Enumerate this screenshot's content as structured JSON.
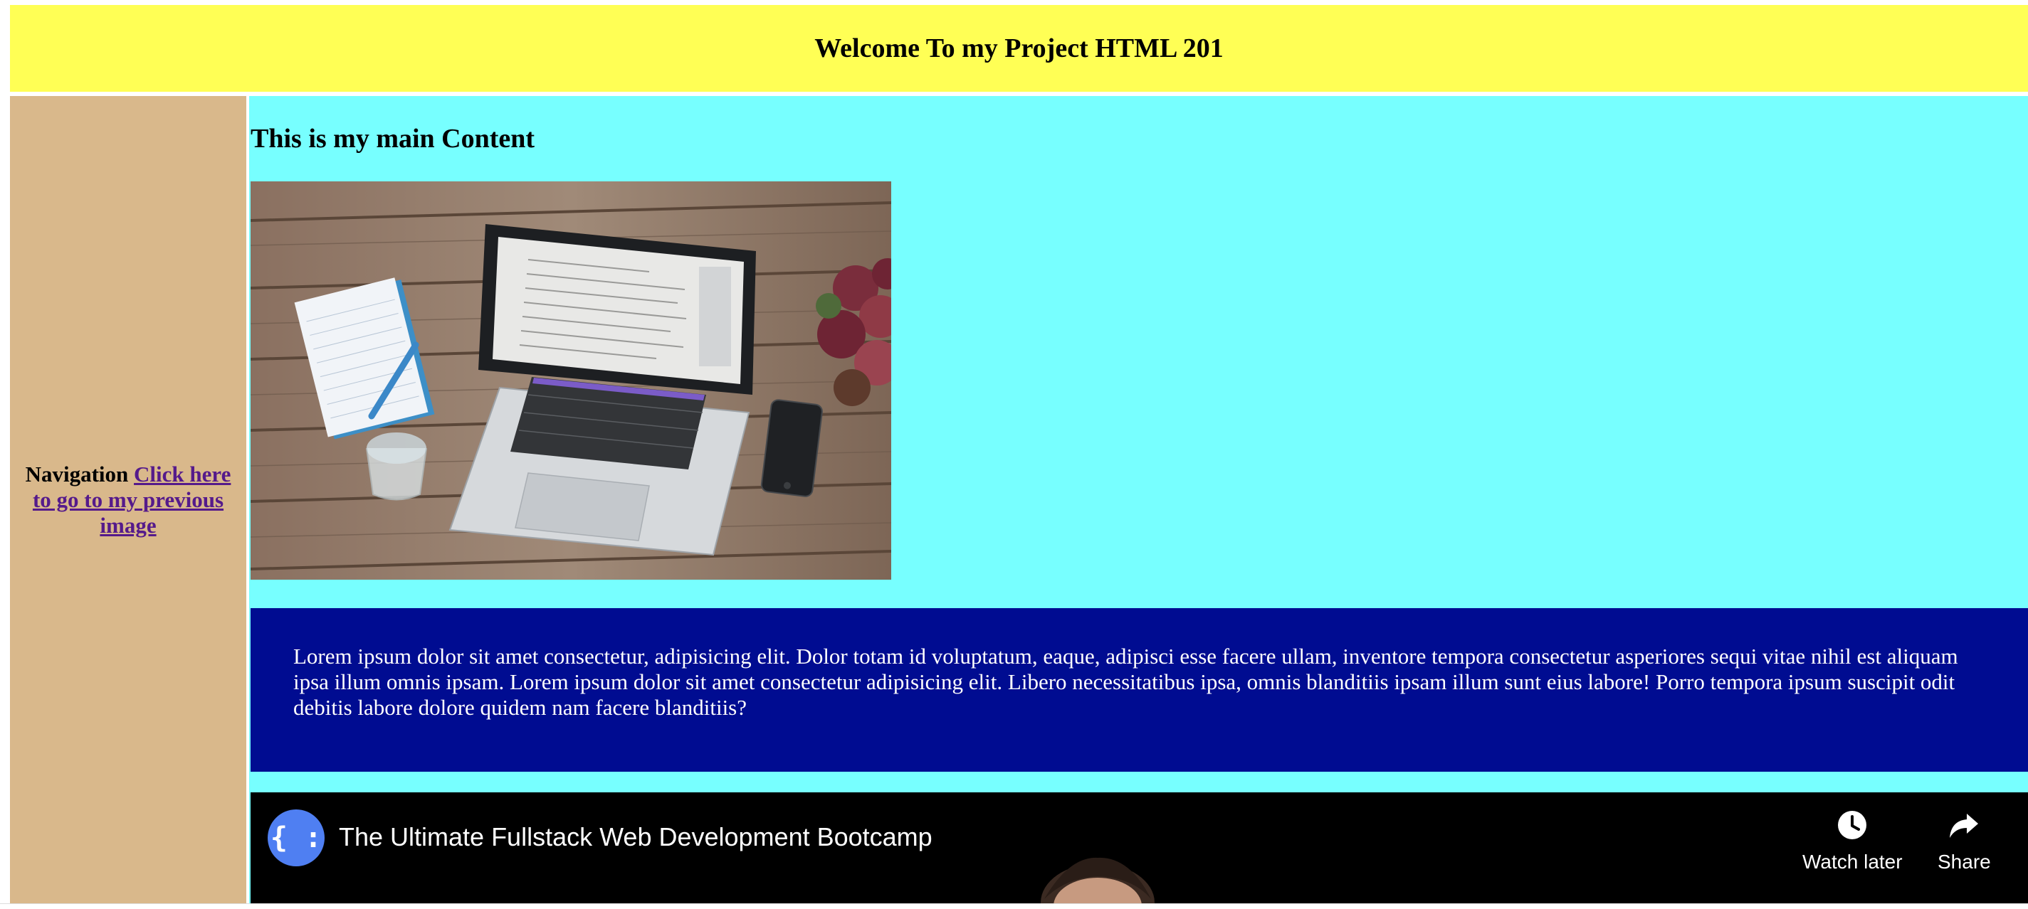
{
  "header": {
    "title": "Welcome To my Project HTML 201"
  },
  "nav": {
    "label": "Navigation",
    "link_text": "Click here to go to my previous image"
  },
  "main": {
    "heading": "This is my main Content",
    "photo_alt": "Laptop on wooden desk with notebook, pen, glass, phone and plant",
    "paragraph": "Lorem ipsum dolor sit amet consectetur, adipisicing elit. Dolor totam id voluptatum, eaque, adipisci esse facere ullam, inventore tempora consectetur asperiores sequi vitae nihil est aliquam ipsa illum omnis ipsam. Lorem ipsum dolor sit amet consectetur adipisicing elit. Libero necessitatibus ipsa, omnis blanditiis ipsam illum sunt eius labore! Porro tempora ipsum suscipit odit debitis labore dolore quidem nam facere blanditiis?"
  },
  "video": {
    "channel_logo": "{ :",
    "title": "The Ultimate Fullstack Web Development Bootcamp",
    "watch_later_label": "Watch later",
    "share_label": "Share",
    "icons": {
      "watch_later": "clock-icon",
      "share": "share-arrow-icon"
    }
  },
  "colors": {
    "header_bg": "#ffff55",
    "nav_bg": "#d9b88b",
    "main_bg": "#77ffff",
    "lorem_bg": "#000c91",
    "link": "#551a8b",
    "channel_logo_bg": "#4f7ff2",
    "video_bg": "#000000"
  }
}
